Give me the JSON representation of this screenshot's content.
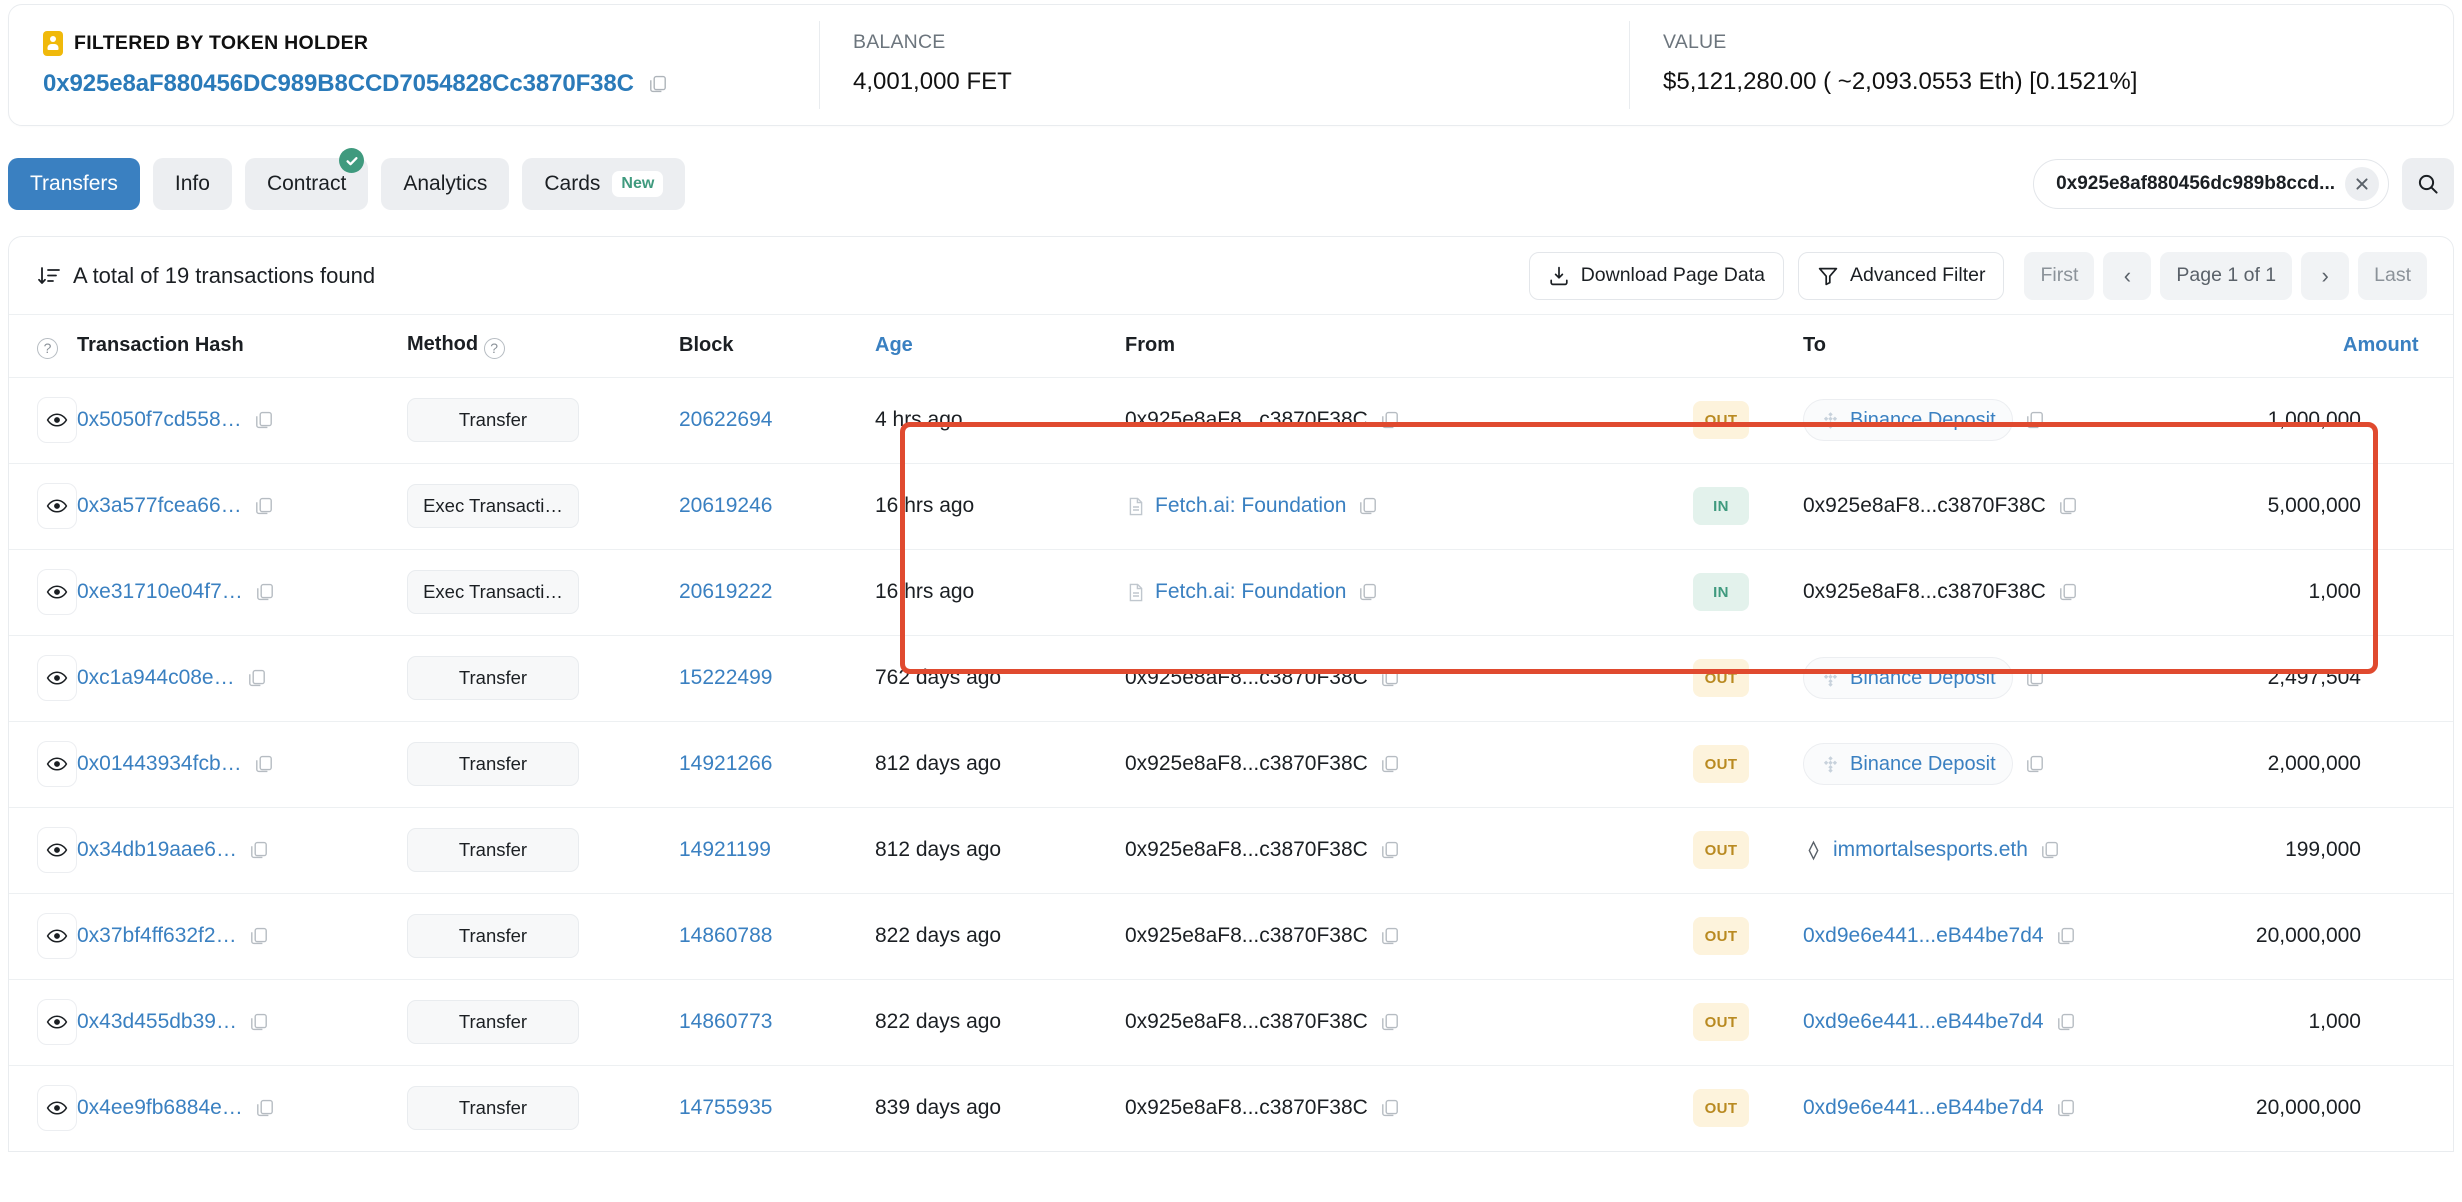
{
  "summary": {
    "filter_label": "FILTERED BY TOKEN HOLDER",
    "filter_address": "0x925e8aF880456DC989B8CCD7054828Cc3870F38C",
    "balance_label": "BALANCE",
    "balance_value": "4,001,000 FET",
    "value_label": "VALUE",
    "value_value": "$5,121,280.00 ( ~2,093.0553 Eth) [0.1521%]"
  },
  "tabs": [
    {
      "label": "Transfers",
      "active": true,
      "check": false,
      "badge": ""
    },
    {
      "label": "Info",
      "active": false,
      "check": false,
      "badge": ""
    },
    {
      "label": "Contract",
      "active": false,
      "check": true,
      "badge": ""
    },
    {
      "label": "Analytics",
      "active": false,
      "check": false,
      "badge": ""
    },
    {
      "label": "Cards",
      "active": false,
      "check": false,
      "badge": "New"
    }
  ],
  "search": {
    "chip_text": "0x925e8af880456dc989b8ccd...",
    "clear_title": "Clear search",
    "search_title": "Search"
  },
  "toolbar": {
    "total_text": "A total of 19 transactions found",
    "download_label": "Download Page Data",
    "advanced_filter_label": "Advanced Filter",
    "first_label": "First",
    "prev_label": "‹",
    "page_label": "Page 1 of 1",
    "next_label": "›",
    "last_label": "Last"
  },
  "table": {
    "headers": {
      "eye": "",
      "hash": "Transaction Hash",
      "method": "Method",
      "block": "Block",
      "age": "Age",
      "from": "From",
      "to": "To",
      "amount": "Amount"
    },
    "rows": [
      {
        "hash": "0x5050f7cd558…",
        "method": "Transfer",
        "block": "20622694",
        "age": "4 hrs ago",
        "from": {
          "text": "0x925e8aF8...c3870F38C",
          "kind": "address"
        },
        "direction": "OUT",
        "to": {
          "text": "Binance Deposit",
          "kind": "pill-binance"
        },
        "amount": "1,000,000"
      },
      {
        "hash": "0x3a577fcea66…",
        "method": "Exec Transacti…",
        "block": "20619246",
        "age": "16 hrs ago",
        "from": {
          "text": "Fetch.ai: Foundation",
          "kind": "named-contract"
        },
        "direction": "IN",
        "to": {
          "text": "0x925e8aF8...c3870F38C",
          "kind": "address"
        },
        "amount": "5,000,000"
      },
      {
        "hash": "0xe31710e04f7…",
        "method": "Exec Transacti…",
        "block": "20619222",
        "age": "16 hrs ago",
        "from": {
          "text": "Fetch.ai: Foundation",
          "kind": "named-contract"
        },
        "direction": "IN",
        "to": {
          "text": "0x925e8aF8...c3870F38C",
          "kind": "address"
        },
        "amount": "1,000"
      },
      {
        "hash": "0xc1a944c08e…",
        "method": "Transfer",
        "block": "15222499",
        "age": "762 days ago",
        "from": {
          "text": "0x925e8aF8...c3870F38C",
          "kind": "address"
        },
        "direction": "OUT",
        "to": {
          "text": "Binance Deposit",
          "kind": "pill-binance"
        },
        "amount": "2,497,504"
      },
      {
        "hash": "0x01443934fcb…",
        "method": "Transfer",
        "block": "14921266",
        "age": "812 days ago",
        "from": {
          "text": "0x925e8aF8...c3870F38C",
          "kind": "address"
        },
        "direction": "OUT",
        "to": {
          "text": "Binance Deposit",
          "kind": "pill-binance"
        },
        "amount": "2,000,000"
      },
      {
        "hash": "0x34db19aae6…",
        "method": "Transfer",
        "block": "14921199",
        "age": "812 days ago",
        "from": {
          "text": "0x925e8aF8...c3870F38C",
          "kind": "address"
        },
        "direction": "OUT",
        "to": {
          "text": "immortalsesports.eth",
          "kind": "ens"
        },
        "amount": "199,000"
      },
      {
        "hash": "0x37bf4ff632f2…",
        "method": "Transfer",
        "block": "14860788",
        "age": "822 days ago",
        "from": {
          "text": "0x925e8aF8...c3870F38C",
          "kind": "address"
        },
        "direction": "OUT",
        "to": {
          "text": "0xd9e6e441...eB44be7d4",
          "kind": "address-link"
        },
        "amount": "20,000,000"
      },
      {
        "hash": "0x43d455db39…",
        "method": "Transfer",
        "block": "14860773",
        "age": "822 days ago",
        "from": {
          "text": "0x925e8aF8...c3870F38C",
          "kind": "address"
        },
        "direction": "OUT",
        "to": {
          "text": "0xd9e6e441...eB44be7d4",
          "kind": "address-link"
        },
        "amount": "1,000"
      },
      {
        "hash": "0x4ee9fb6884e…",
        "method": "Transfer",
        "block": "14755935",
        "age": "839 days ago",
        "from": {
          "text": "0x925e8aF8...c3870F38C",
          "kind": "address"
        },
        "direction": "OUT",
        "to": {
          "text": "0xd9e6e441...eB44be7d4",
          "kind": "address-link"
        },
        "amount": "20,000,000"
      }
    ]
  },
  "annotation": {
    "highlight_color": "#e04a2f"
  },
  "colors": {
    "link": "#3a80c1",
    "active_tab": "#3a80c1",
    "out_badge_bg": "#fdf3dc",
    "out_badge_fg": "#b98a21",
    "in_badge_bg": "#e3f2ec",
    "in_badge_fg": "#3f9a7e",
    "token_icon": "#f0b90b"
  },
  "icons": {
    "token_holder": "token-holder-icon",
    "copy": "copy-icon",
    "eye": "eye-icon",
    "search": "search-icon",
    "close": "close-icon",
    "download": "download-icon",
    "filter": "filter-icon",
    "sort": "sort-descending-icon",
    "check": "check-icon",
    "contract": "contract-document-icon",
    "binance": "binance-logo-icon",
    "ens": "ens-diamond-icon",
    "help": "help-circle-icon"
  }
}
